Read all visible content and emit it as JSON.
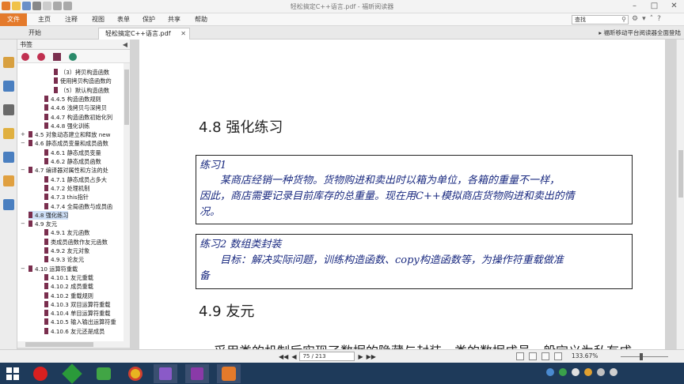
{
  "window": {
    "title": "轻松搞定C++语言.pdf - 福昕阅读器"
  },
  "menubar": {
    "file": "文件",
    "items": [
      "主页",
      "注释",
      "视图",
      "表单",
      "保护",
      "共享",
      "帮助"
    ],
    "search_placeholder": "查找"
  },
  "tabs": [
    {
      "label": "开始"
    },
    {
      "label": "轻松搞定C++语言.pdf"
    }
  ],
  "promo": "福昕移动平台阅读器全面登陆",
  "bookmarks": {
    "title": "书签",
    "items": [
      {
        "label": "（3）拷贝构造函数",
        "indent": 3
      },
      {
        "label": "使用拷贝构造函数的",
        "indent": 3
      },
      {
        "label": "（5）默认构造函数",
        "indent": 3
      },
      {
        "label": "4.4.5 构造函数规则",
        "indent": 2
      },
      {
        "label": "4.4.6 浅拷贝与深拷贝",
        "indent": 2
      },
      {
        "label": "4.4.7 构造函数初始化列",
        "indent": 2
      },
      {
        "label": "4.4.8 强化训练",
        "indent": 2
      },
      {
        "label": "4.5 对象动态建立和释放 new",
        "indent": 1,
        "expand": "+"
      },
      {
        "label": "4.6 静态成员变量和成员函数",
        "indent": 1,
        "expand": "−"
      },
      {
        "label": "4.6.1 静态成员变量",
        "indent": 2
      },
      {
        "label": "4.6.2 静态成员函数",
        "indent": 2
      },
      {
        "label": "4.7 编译器对属性和方法的处",
        "indent": 1,
        "expand": "−"
      },
      {
        "label": "4.7.1 静态成员占多大",
        "indent": 2
      },
      {
        "label": "4.7.2 处理机制",
        "indent": 2
      },
      {
        "label": "4.7.3 this指针",
        "indent": 2
      },
      {
        "label": "4.7.4 全局函数与成员函",
        "indent": 2
      },
      {
        "label": "4.8 强化练习",
        "indent": 1,
        "selected": true
      },
      {
        "label": "4.9 友元",
        "indent": 1,
        "expand": "−"
      },
      {
        "label": "4.9.1 友元函数",
        "indent": 2
      },
      {
        "label": "类成员函数作友元函数",
        "indent": 2
      },
      {
        "label": "4.9.2 友元对象",
        "indent": 2
      },
      {
        "label": "4.9.3 论友元",
        "indent": 2
      },
      {
        "label": "4.10 运算符重载",
        "indent": 1,
        "expand": "−"
      },
      {
        "label": "4.10.1 友元重载",
        "indent": 2
      },
      {
        "label": "4.10.2 成员重载",
        "indent": 2
      },
      {
        "label": "4.10.2 重载规则",
        "indent": 2
      },
      {
        "label": "4.10.3 双目运算符重载",
        "indent": 2
      },
      {
        "label": "4.10.4 单目运算符重载",
        "indent": 2
      },
      {
        "label": "4.10.5 输入输出运算符重",
        "indent": 2
      },
      {
        "label": "4.10.6 友元还是成员",
        "indent": 2
      }
    ]
  },
  "document": {
    "heading1": "4.8 强化练习",
    "exercise1_line1": "练习1",
    "exercise1_line2": "　　某商店经销一种货物。货物购进和卖出时以箱为单位，各箱的重量不一样，",
    "exercise1_line3": "因此，商店需要记录目前库存的总重量。现在用C++模拟商店货物购进和卖出的情",
    "exercise1_line4": "况。",
    "exercise2_line1": "练习2 数组类封装",
    "exercise2_line2": "　　目标：解决实际问题，训练构造函数、copy构造函数等，为操作符重载做准",
    "exercise2_line3": "备",
    "heading2": "4.9 友元",
    "body_text": "采用类的机制后实现了数据的隐藏与封装，类的数据成员一般定义为私有成"
  },
  "status": {
    "page_indicator": "75 / 213",
    "zoom": "133.67%"
  },
  "colors": {
    "accent": "#e47a2b",
    "taskbar": "#1e3a5a",
    "ink": "#1a2a80"
  }
}
